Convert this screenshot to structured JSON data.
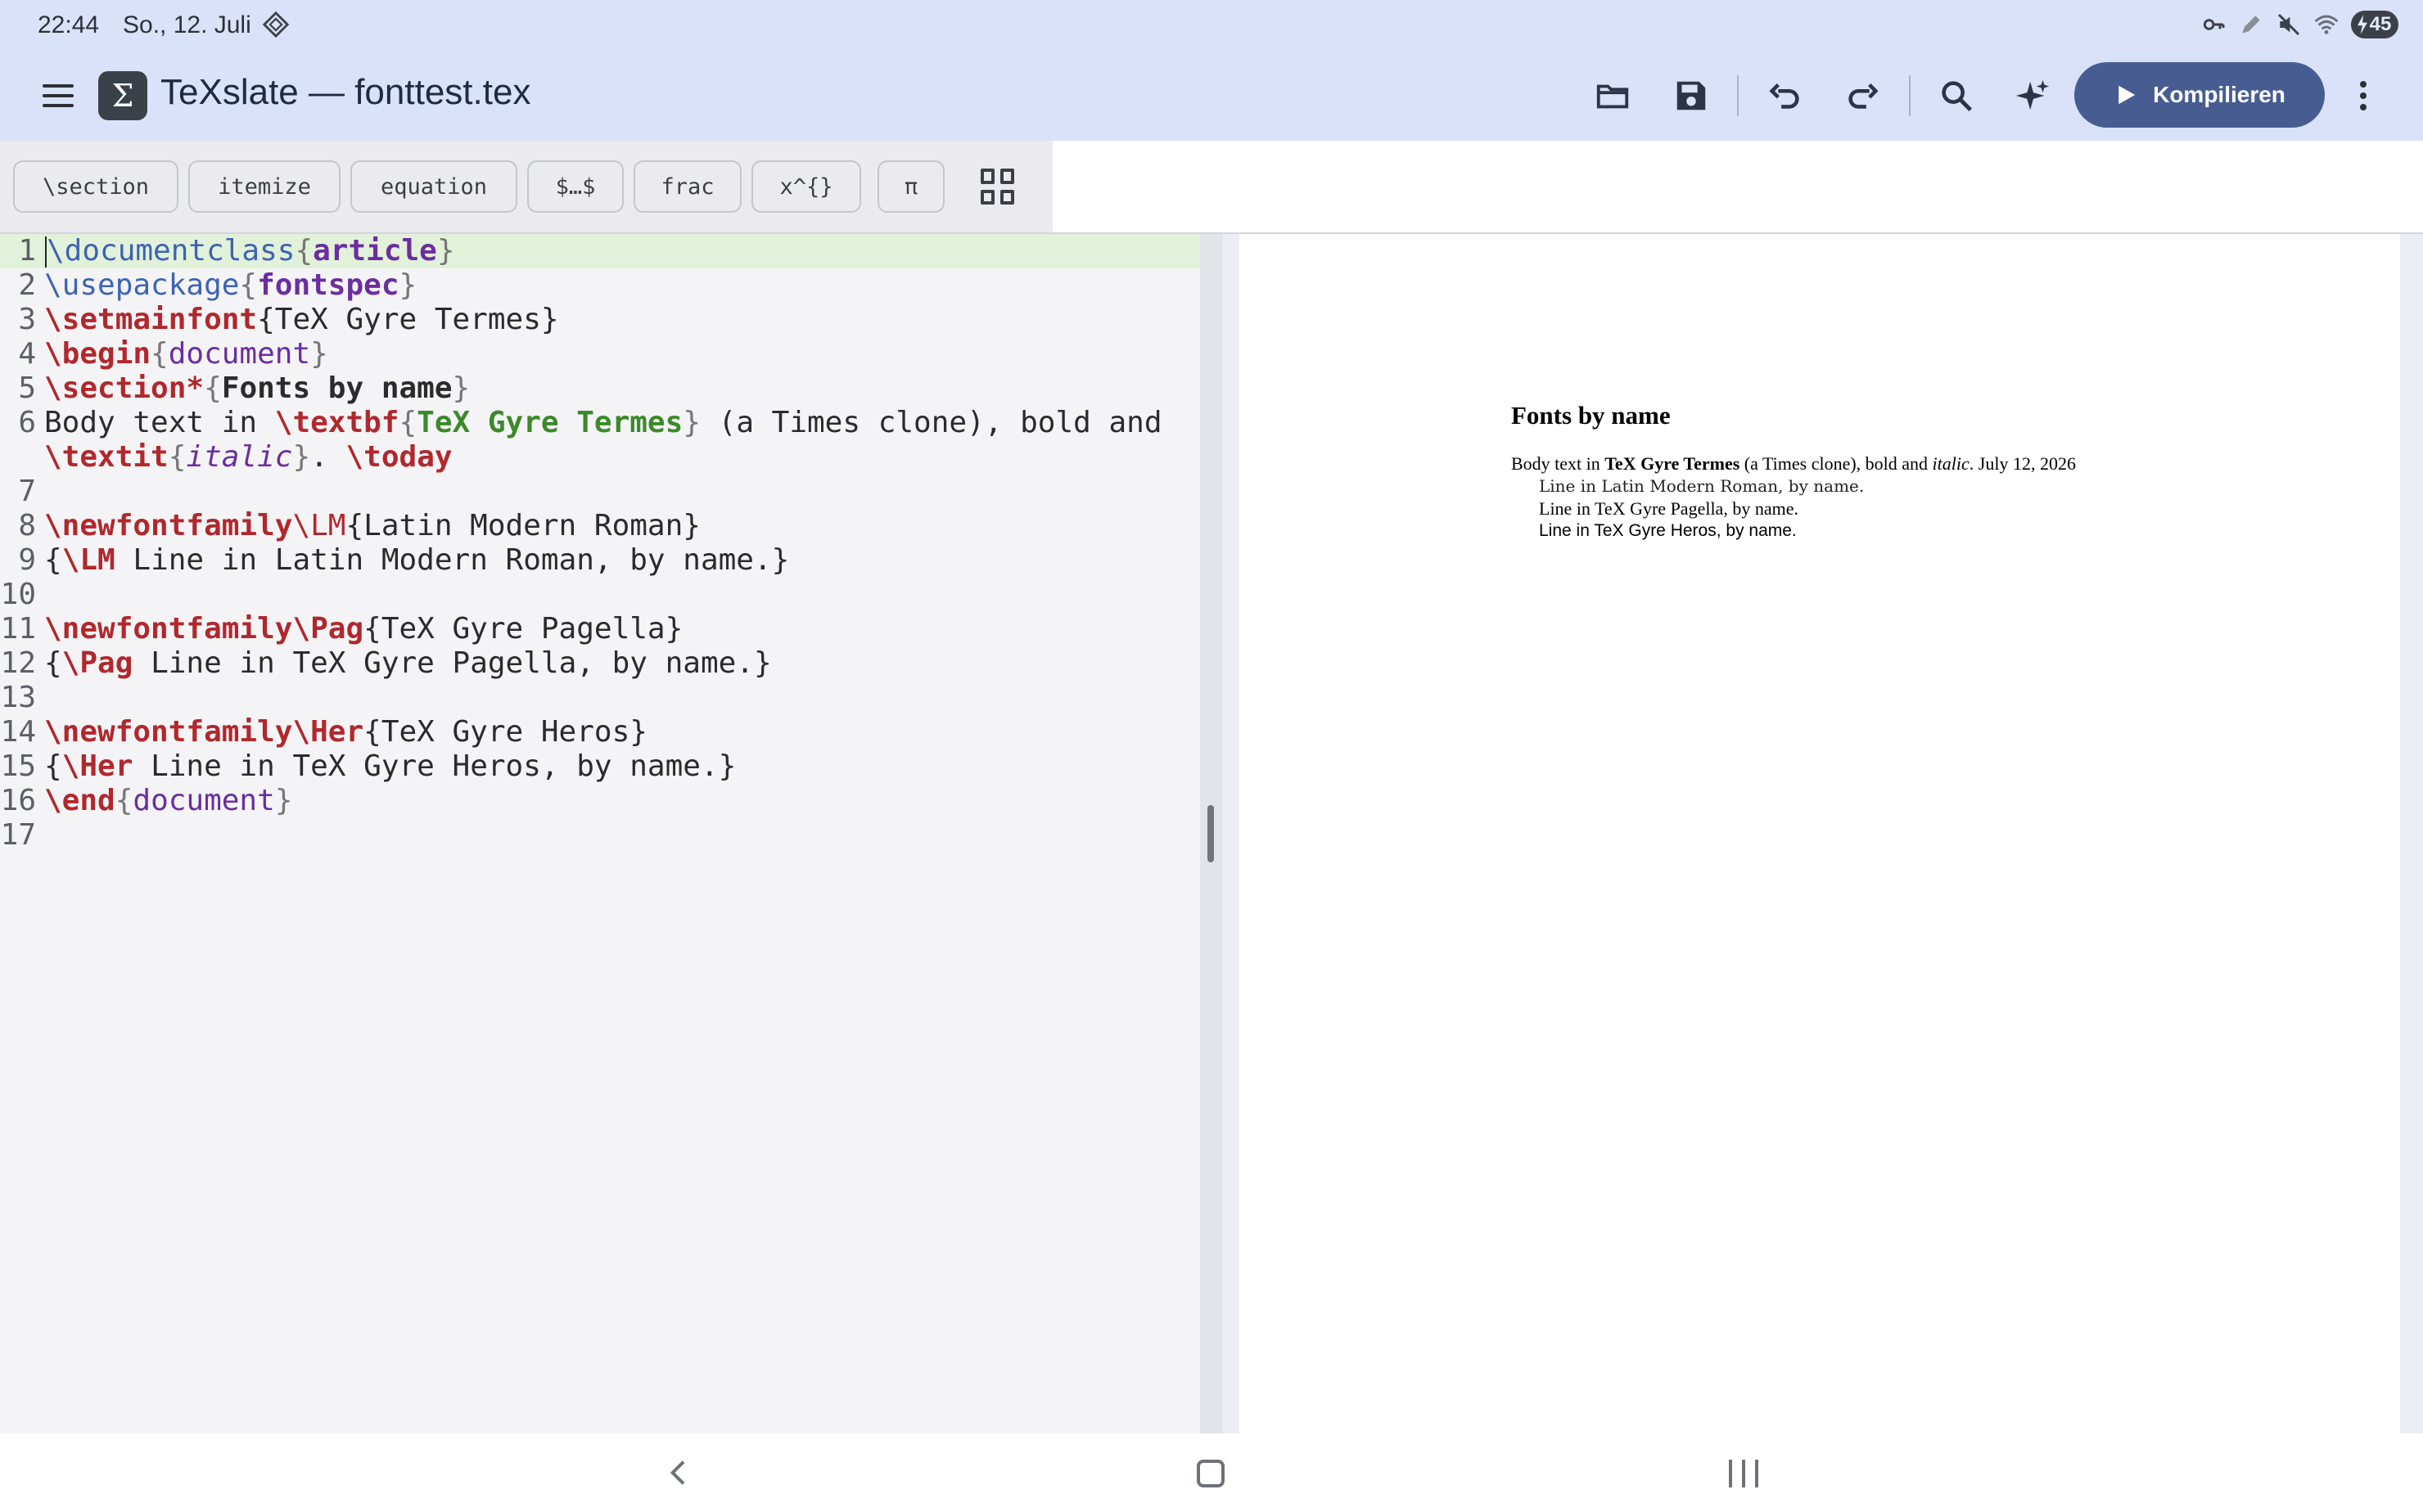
{
  "status_bar": {
    "time": "22:44",
    "date": "So., 12. Juli",
    "battery": "45",
    "icons": [
      "app-notification-icon",
      "vpn-key-icon",
      "pen-icon",
      "mute-icon",
      "wifi-icon",
      "battery-charging-icon"
    ]
  },
  "app_bar": {
    "logo_glyph": "Σ",
    "title": "TeXslate — fonttest.tex",
    "compile_label": "Kompilieren",
    "actions": [
      "folder-open-icon",
      "save-icon",
      "undo-icon",
      "redo-icon",
      "search-icon",
      "ai-sparkle-icon",
      "more-vert-icon"
    ],
    "colors": {
      "app_bar_bg": "#d9e2f9",
      "compile_bg": "#475d92"
    }
  },
  "snippets": [
    {
      "label": "\\section"
    },
    {
      "label": "itemize"
    },
    {
      "label": "equation"
    },
    {
      "label": "$…$"
    },
    {
      "label": "frac"
    },
    {
      "label": "x^{}"
    },
    {
      "label": "π"
    }
  ],
  "editor": {
    "line_numbers": [
      "1",
      "2",
      "3",
      "4",
      "5",
      "6",
      "7",
      "8",
      "9",
      "10",
      "11",
      "12",
      "13",
      "14",
      "15",
      "16",
      "17"
    ],
    "code": {
      "l1": {
        "cmd": "\\documentclass",
        "open": "{",
        "arg": "article",
        "close": "}"
      },
      "l2": {
        "cmd": "\\usepackage",
        "open": "{",
        "arg": "fontspec",
        "close": "}"
      },
      "l3": {
        "cmd": "\\setmainfont",
        "rest": "{TeX Gyre Termes}"
      },
      "l4": {
        "cmd": "\\begin",
        "open": "{",
        "arg": "document",
        "close": "}"
      },
      "l5": {
        "cmd": "\\section*",
        "open": "{",
        "arg": "Fonts by name",
        "close": "}"
      },
      "l6": {
        "pre": "Body text in ",
        "cmd": "\\textbf",
        "open": "{",
        "arg": "TeX Gyre Termes",
        "close": "}",
        "rest": " (a Times clone), bold and"
      },
      "l6b": {
        "cmd": "\\textit",
        "open": "{",
        "arg": "italic",
        "close": "}",
        "mid": ". ",
        "cmd2": "\\today"
      },
      "l8": {
        "cmd": "\\newfontfamily",
        "cmd2": "\\LM",
        "rest": "{Latin Modern Roman}"
      },
      "l9": {
        "open": "{",
        "cmd": "\\LM",
        "rest": " Line in Latin Modern Roman, by name.}"
      },
      "l11": {
        "cmd": "\\newfontfamily",
        "cmd2": "\\Pag",
        "rest": "{TeX Gyre Pagella}"
      },
      "l12": {
        "open": "{",
        "cmd": "\\Pag",
        "rest": " Line in TeX Gyre Pagella, by name.}"
      },
      "l14": {
        "cmd": "\\newfontfamily",
        "cmd2": "\\Her",
        "rest": "{TeX Gyre Heros}"
      },
      "l15": {
        "open": "{",
        "cmd": "\\Her",
        "rest": " Line in TeX Gyre Heros, by name.}"
      },
      "l16": {
        "cmd": "\\end",
        "open": "{",
        "arg": "document",
        "close": "}"
      }
    }
  },
  "preview": {
    "heading": "Fonts by name",
    "body_pre": "Body text in ",
    "body_bold": "TeX Gyre Termes",
    "body_mid": " (a Times clone), bold and ",
    "body_italic": "italic",
    "body_post": ". July 12, 2026",
    "line_lm": "Line in Latin Modern Roman, by name.",
    "line_pag": "Line in TeX Gyre Pagella, by name.",
    "line_her": "Line in TeX Gyre Heros, by name."
  },
  "nav_bar": {
    "buttons": [
      "back-icon",
      "home-icon",
      "recents-icon"
    ]
  }
}
